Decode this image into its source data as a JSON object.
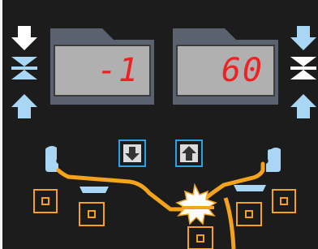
{
  "displays": {
    "left_value": "-1",
    "right_value": "60"
  },
  "icons": {
    "left_down": "arrow-down-icon",
    "left_center": "converge-icon",
    "left_up": "arrow-up-icon",
    "right_down": "arrow-down-icon",
    "right_center": "converge-icon",
    "right_up": "arrow-up-icon",
    "spark": "spark-icon"
  },
  "buttons": {
    "down": "arrow-down-icon",
    "up": "arrow-up-icon"
  },
  "colors": {
    "panel_background": "#1c1c1c",
    "display_background": "#b0b0b0",
    "display_digits": "#ee2222",
    "button_border": "#29a2e6",
    "guide_blue": "#a9d6f5",
    "wire_orange": "#f5a31c",
    "housing_orange": "#f5a31c"
  }
}
